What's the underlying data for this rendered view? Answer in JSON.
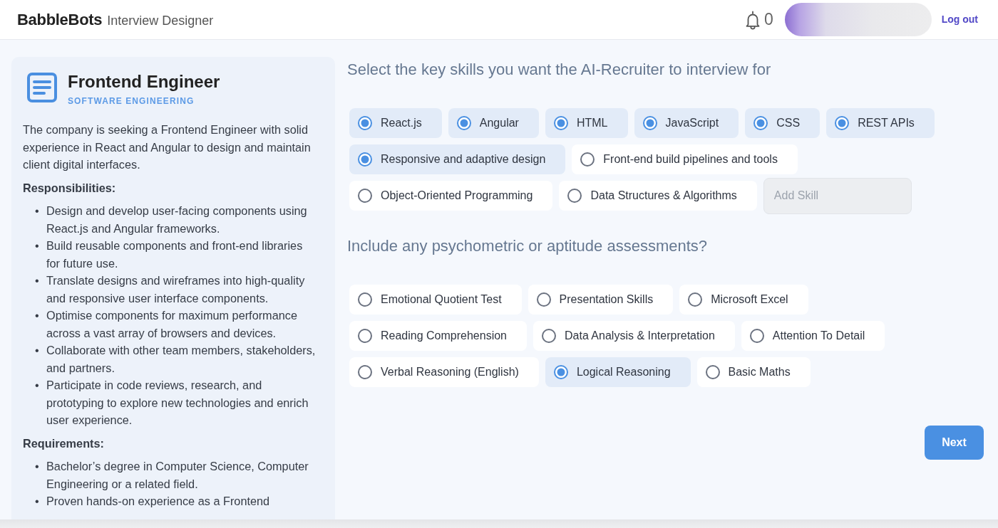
{
  "header": {
    "brand": "BabbleBots",
    "subtitle": "Interview Designer",
    "notifications": {
      "count": "0"
    },
    "logout": "Log out"
  },
  "job": {
    "title": "Frontend Engineer",
    "department": "SOFTWARE ENGINEERING",
    "summary": "The company is seeking a Frontend Engineer with solid experience in React and Angular to design and maintain client digital interfaces.",
    "sections": [
      {
        "heading": "Responsibilities:",
        "items": [
          {
            "bullet": "•",
            "text": "Design and develop user-facing components using React.js and Angular frameworks."
          },
          {
            "bullet": "•",
            "text": "Build reusable components and front-end libraries for future use."
          },
          {
            "bullet": "•",
            "text": "Translate designs and wireframes into high-quality and responsive user interface components."
          },
          {
            "bullet": "•",
            "text": "Optimise components for maximum performance across a vast array of browsers and devices."
          },
          {
            "bullet": "•",
            "text": "Collaborate with other team members, stakeholders, and partners."
          },
          {
            "bullet": "•",
            "text": "Participate in code reviews, research, and prototyping to explore new technologies and enrich user experience."
          }
        ]
      },
      {
        "heading": "Requirements:",
        "items": [
          {
            "bullet": "•",
            "text": "Bachelor’s degree in Computer Science, Computer Engineering or a related field."
          },
          {
            "bullet": "•",
            "text": "Proven hands-on experience as a Frontend"
          }
        ]
      }
    ]
  },
  "skills": {
    "heading": "Select the key skills you want the AI-Recruiter to interview for",
    "options": [
      {
        "label": "React.js",
        "selected": true
      },
      {
        "label": "Angular",
        "selected": true
      },
      {
        "label": "HTML",
        "selected": true
      },
      {
        "label": "JavaScript",
        "selected": true
      },
      {
        "label": "CSS",
        "selected": true
      },
      {
        "label": "REST APIs",
        "selected": true
      },
      {
        "label": "Responsive and adaptive design",
        "selected": true
      },
      {
        "label": "Front-end build pipelines and tools",
        "selected": false
      },
      {
        "label": "Object-Oriented Programming",
        "selected": false
      },
      {
        "label": "Data Structures & Algorithms",
        "selected": false
      }
    ],
    "add_field": {
      "placeholder": "Add Skill"
    }
  },
  "assessments": {
    "heading": "Include any psychometric or aptitude assessments?",
    "options": [
      {
        "label": "Emotional Quotient Test",
        "selected": false
      },
      {
        "label": "Presentation Skills",
        "selected": false
      },
      {
        "label": "Microsoft Excel",
        "selected": false
      },
      {
        "label": "Reading Comprehension",
        "selected": false
      },
      {
        "label": "Data Analysis & Interpretation",
        "selected": false
      },
      {
        "label": "Attention To Detail",
        "selected": false
      },
      {
        "label": "Verbal Reasoning (English)",
        "selected": false
      },
      {
        "label": "Logical Reasoning",
        "selected": true
      },
      {
        "label": "Basic Maths",
        "selected": false
      }
    ]
  },
  "next_button": "Next"
}
